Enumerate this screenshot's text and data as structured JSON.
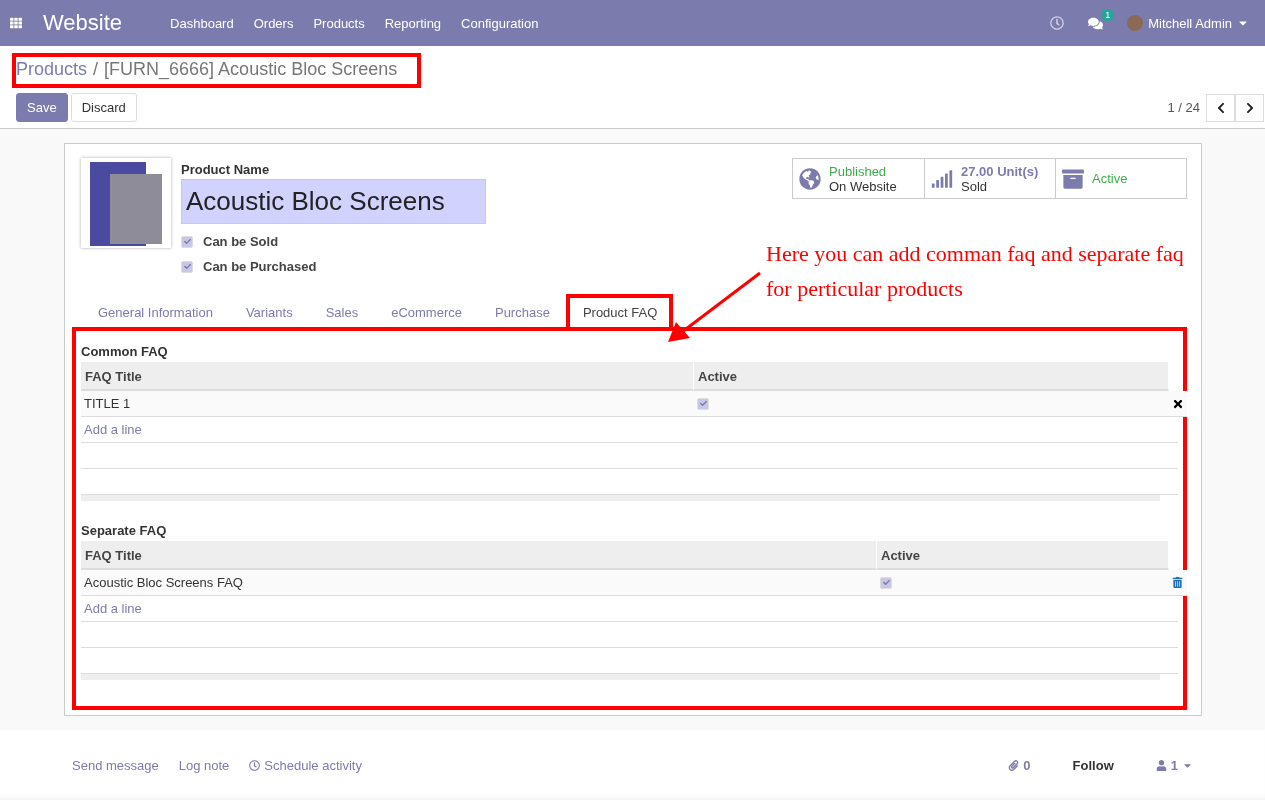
{
  "navbar": {
    "app_name": "Website",
    "menu": [
      "Dashboard",
      "Orders",
      "Products",
      "Reporting",
      "Configuration"
    ],
    "message_count": "1",
    "user": "Mitchell Admin"
  },
  "breadcrumb": {
    "parent": "Products",
    "separator": "/",
    "current": "[FURN_6666] Acoustic Bloc Screens",
    "highlighted": true
  },
  "buttons": {
    "save": "Save",
    "discard": "Discard"
  },
  "pager": "1 / 24",
  "product": {
    "name_label": "Product Name",
    "name": "Acoustic Bloc Screens",
    "options": [
      {
        "label": "Can be Sold",
        "checked": true
      },
      {
        "label": "Can be Purchased",
        "checked": true
      }
    ]
  },
  "stat_buttons": [
    {
      "kind": "website",
      "status": "Published",
      "caption": "On Website"
    },
    {
      "kind": "sold",
      "value": "27.00",
      "unit": "Unit(s)",
      "caption": "Sold"
    },
    {
      "kind": "archive",
      "status": "Active"
    }
  ],
  "tabs": [
    {
      "label": "General Information",
      "selected": false,
      "highlighted": false
    },
    {
      "label": "Variants",
      "selected": false,
      "highlighted": false
    },
    {
      "label": "Sales",
      "selected": false,
      "highlighted": false
    },
    {
      "label": "eCommerce",
      "selected": false,
      "highlighted": false
    },
    {
      "label": "Purchase",
      "selected": false,
      "highlighted": false
    },
    {
      "label": "Product FAQ",
      "selected": true,
      "highlighted": true
    }
  ],
  "faq_panel": {
    "highlighted": true,
    "sections": [
      {
        "title": "Common FAQ",
        "columns": [
          "FAQ Title",
          "Active"
        ],
        "kind": "cross",
        "rows": [
          {
            "title": "TITLE 1",
            "active": true
          }
        ],
        "add_line": "Add a line"
      },
      {
        "title": "Separate FAQ",
        "columns": [
          "FAQ Title",
          "Active"
        ],
        "kind": "trash",
        "rows": [
          {
            "title": "Acoustic Bloc Screens FAQ",
            "active": true
          }
        ],
        "add_line": "Add a line"
      }
    ]
  },
  "annotation": {
    "lines": [
      "Here you can add comman faq and separate faq",
      "for perticular products"
    ]
  },
  "chatter": {
    "actions": [
      {
        "kind": "link",
        "label": "Send message"
      },
      {
        "kind": "link",
        "label": "Log note"
      },
      {
        "kind": "activity",
        "label": "Schedule activity"
      }
    ],
    "attachments": "0",
    "follow": "Follow",
    "followers": "1"
  }
}
